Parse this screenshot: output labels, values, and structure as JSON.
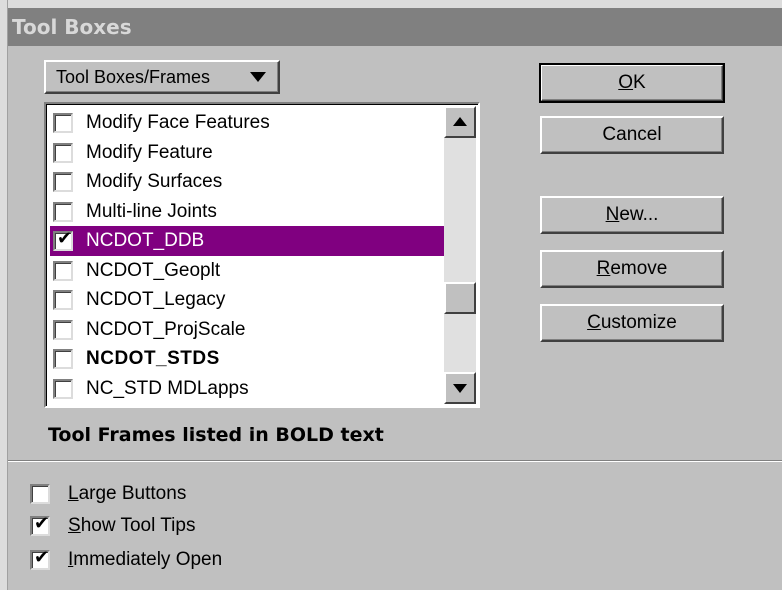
{
  "window": {
    "title": "Tool Boxes"
  },
  "dropdown": {
    "label": "Tool Boxes/Frames"
  },
  "list": {
    "items": [
      {
        "label": "Modify Face Features",
        "checked": false,
        "selected": false,
        "bold": false
      },
      {
        "label": "Modify Feature",
        "checked": false,
        "selected": false,
        "bold": false
      },
      {
        "label": "Modify Surfaces",
        "checked": false,
        "selected": false,
        "bold": false
      },
      {
        "label": "Multi-line Joints",
        "checked": false,
        "selected": false,
        "bold": false
      },
      {
        "label": "NCDOT_DDB",
        "checked": true,
        "selected": true,
        "bold": false
      },
      {
        "label": "NCDOT_Geoplt",
        "checked": false,
        "selected": false,
        "bold": false
      },
      {
        "label": "NCDOT_Legacy",
        "checked": false,
        "selected": false,
        "bold": false
      },
      {
        "label": "NCDOT_ProjScale",
        "checked": false,
        "selected": false,
        "bold": false
      },
      {
        "label": "NCDOT_STDS",
        "checked": false,
        "selected": false,
        "bold": true
      },
      {
        "label": "NC_STD MDLapps",
        "checked": false,
        "selected": false,
        "bold": false
      }
    ]
  },
  "note": "Tool Frames listed in BOLD text",
  "buttons": {
    "ok": {
      "mnemonic": "O",
      "rest": "K"
    },
    "cancel": {
      "label": "Cancel"
    },
    "new": {
      "mnemonic": "N",
      "rest": "ew..."
    },
    "remove": {
      "mnemonic": "R",
      "rest": "emove"
    },
    "customize": {
      "mnemonic": "C",
      "rest": "ustomize"
    }
  },
  "options": {
    "large_buttons": {
      "mnemonic": "L",
      "rest": "arge Buttons",
      "checked": false
    },
    "show_tool_tips": {
      "mnemonic": "S",
      "rest": "how Tool Tips",
      "checked": true
    },
    "immediately_open": {
      "mnemonic": "I",
      "rest": "mmediately Open",
      "checked": true
    }
  },
  "glyphs": {
    "check": "✔"
  },
  "colors": {
    "selection": "#800080",
    "face": "#c0c0c0",
    "title_bar": "#808080"
  }
}
